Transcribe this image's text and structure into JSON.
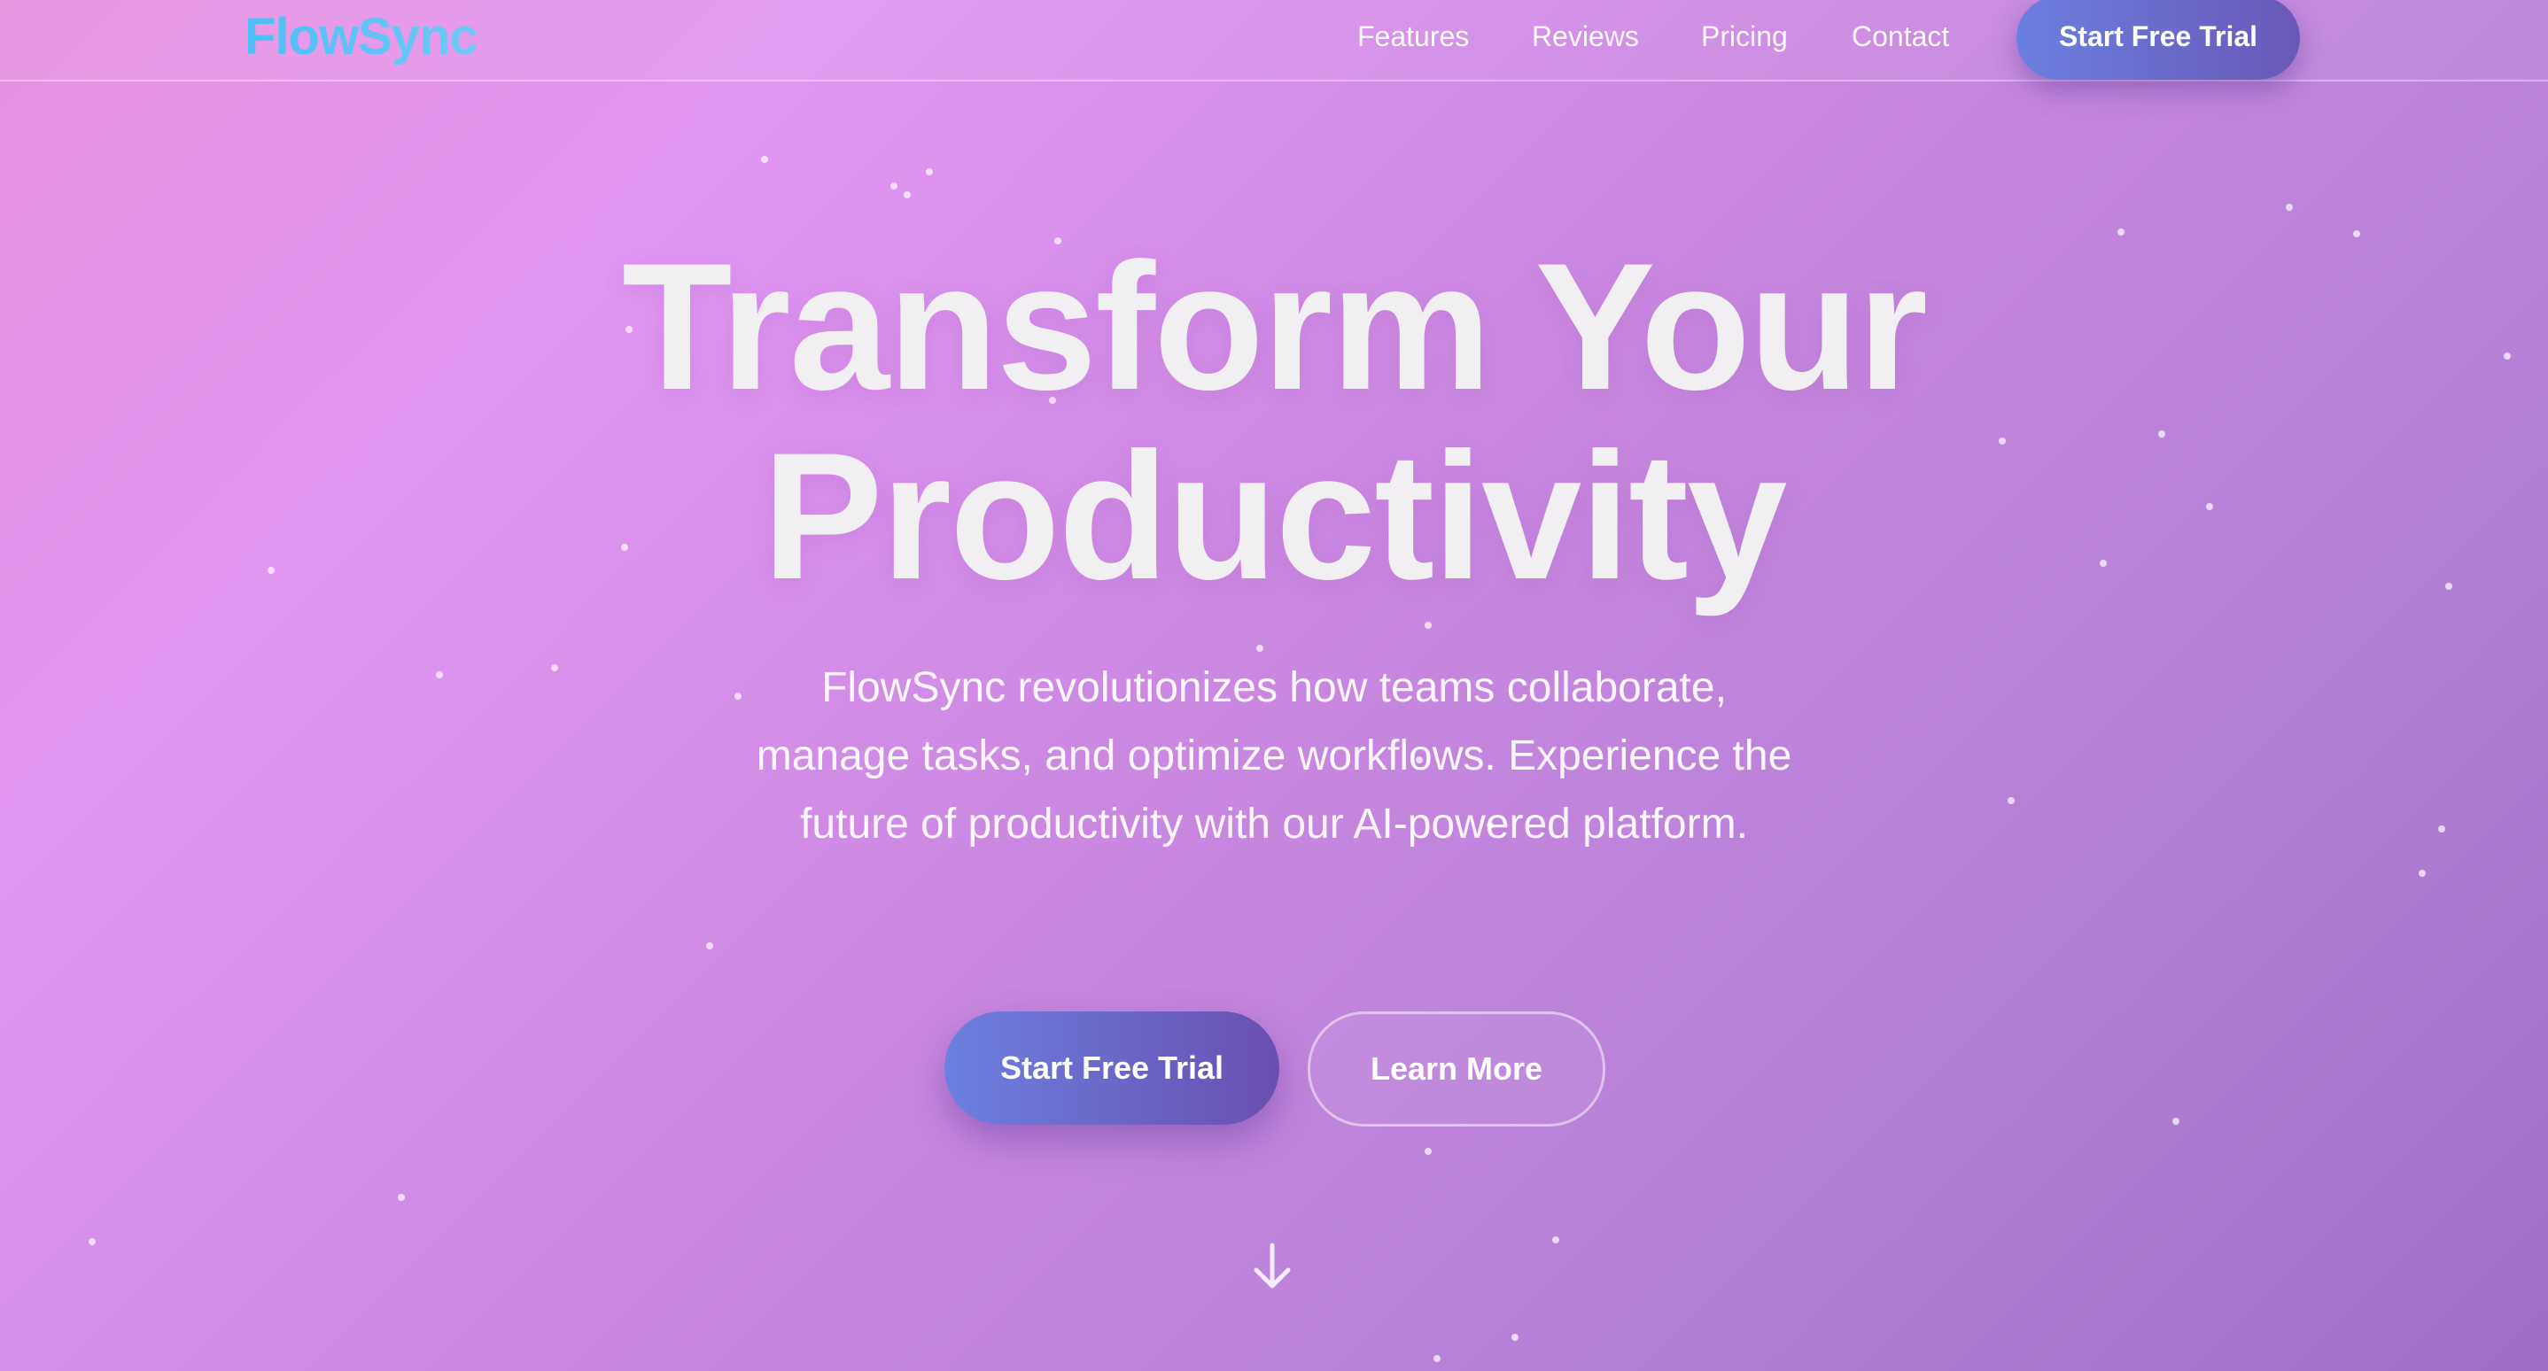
{
  "header": {
    "logo": "FlowSync",
    "nav": [
      "Features",
      "Reviews",
      "Pricing",
      "Contact"
    ],
    "cta_label": "Start Free Trial"
  },
  "hero": {
    "headline_line1": "Transform Your",
    "headline_line2": "Productivity",
    "subtitle": "FlowSync revolutionizes how teams collaborate, manage tasks, and optimize workflows. Experience the future of productivity with our AI-powered platform.",
    "primary_cta": "Start Free Trial",
    "secondary_cta": "Learn More",
    "scroll_icon": "arrow-down-icon"
  },
  "colors": {
    "background_start": "#e792e0",
    "background_end": "#a06cc6",
    "logo": "#4fc3f2",
    "button_start": "#6b80e0",
    "button_end": "#6a4fb0"
  }
}
